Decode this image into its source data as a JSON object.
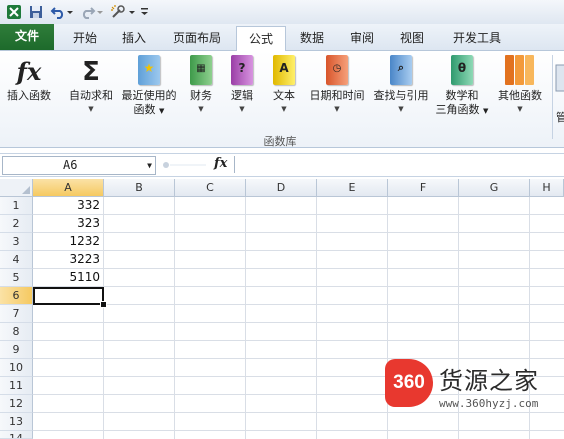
{
  "window": {
    "quick_access": [
      "save-icon",
      "undo-icon",
      "redo-icon",
      "tool-icon"
    ]
  },
  "tabs": [
    {
      "label": "文件"
    },
    {
      "label": "开始"
    },
    {
      "label": "插入"
    },
    {
      "label": "页面布局"
    },
    {
      "label": "公式"
    },
    {
      "label": "数据"
    },
    {
      "label": "审阅"
    },
    {
      "label": "视图"
    },
    {
      "label": "开发工具"
    }
  ],
  "active_tab": "公式",
  "ribbon": {
    "insert_function": "插入函数",
    "autosum": "自动求和",
    "recent_1": "最近使用的",
    "recent_2": "函数",
    "finance": "财务",
    "logic": "逻辑",
    "text": "文本",
    "datetime": "日期和时间",
    "lookup": "查找与引用",
    "math_1": "数学和",
    "math_2": "三角函数",
    "other": "其他函数",
    "group_label": "函数库",
    "fx_glyph": "fx",
    "sigma_glyph": "Σ",
    "logic_glyph": "?",
    "text_glyph": "A",
    "math_glyph": "θ",
    "cut_char": "管"
  },
  "formula_bar": {
    "name_box": "A6",
    "fx_label": "fx",
    "formula": ""
  },
  "sheet": {
    "columns": [
      "A",
      "B",
      "C",
      "D",
      "E",
      "F",
      "G",
      "H"
    ],
    "rows": [
      "1",
      "2",
      "3",
      "4",
      "5",
      "6",
      "7",
      "8",
      "9",
      "10",
      "11",
      "12",
      "13",
      "14"
    ],
    "cells_A": [
      "332",
      "323",
      "1232",
      "3223",
      "5110"
    ],
    "selected_cell": "A6"
  },
  "watermark": {
    "logo_text": "360",
    "brand": "货源之家",
    "url": "www.360hyzj.com"
  },
  "colors": {
    "file_tab": "#1d6a2b",
    "selection_header": "#f5c961",
    "watermark_red": "#e8382f"
  }
}
